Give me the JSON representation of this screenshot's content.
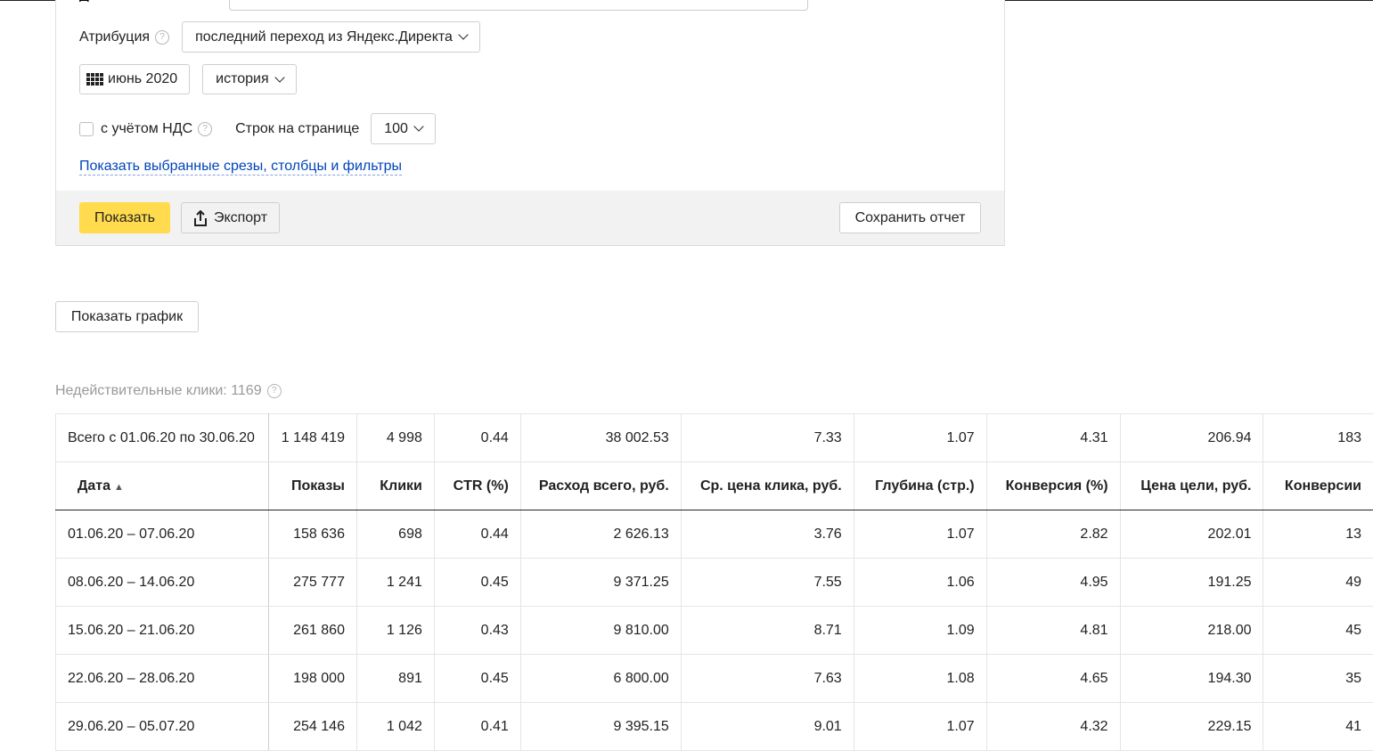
{
  "filters": {
    "attribution_label": "Атрибуция",
    "attribution_value": "последний переход из Яндекс.Директа",
    "period_label": "июнь 2020",
    "history_label": "история",
    "vat_label": "с учётом НДС",
    "rows_per_page_label": "Строк на странице",
    "rows_per_page_value": "100",
    "show_selected_link": "Показать выбранные срезы, столбцы и фильтры",
    "cut_text": "Д"
  },
  "actions": {
    "show_label": "Показать",
    "export_label": "Экспорт",
    "save_report_label": "Сохранить отчет",
    "show_chart_label": "Показать график"
  },
  "invalid_clicks": "Недействительные клики: 1169",
  "table": {
    "total": [
      "Всего с 01.06.20 по 30.06.20",
      "1 148 419",
      "4 998",
      "0.44",
      "38 002.53",
      "7.33",
      "1.07",
      "4.31",
      "206.94",
      "183"
    ],
    "headers": [
      "Дата",
      "Показы",
      "Клики",
      "CTR (%)",
      "Расход всего, руб.",
      "Ср. цена клика, руб.",
      "Глубина (стр.)",
      "Конверсия (%)",
      "Цена цели, руб.",
      "Конверсии"
    ],
    "rows": [
      [
        "01.06.20 – 07.06.20",
        "158 636",
        "698",
        "0.44",
        "2 626.13",
        "3.76",
        "1.07",
        "2.82",
        "202.01",
        "13"
      ],
      [
        "08.06.20 – 14.06.20",
        "275 777",
        "1 241",
        "0.45",
        "9 371.25",
        "7.55",
        "1.06",
        "4.95",
        "191.25",
        "49"
      ],
      [
        "15.06.20 – 21.06.20",
        "261 860",
        "1 126",
        "0.43",
        "9 810.00",
        "8.71",
        "1.09",
        "4.81",
        "218.00",
        "45"
      ],
      [
        "22.06.20 – 28.06.20",
        "198 000",
        "891",
        "0.45",
        "6 800.00",
        "7.63",
        "1.08",
        "4.65",
        "194.30",
        "35"
      ],
      [
        "29.06.20 – 05.07.20",
        "254 146",
        "1 042",
        "0.41",
        "9 395.15",
        "9.01",
        "1.07",
        "4.32",
        "229.15",
        "41"
      ]
    ]
  },
  "colors": {
    "accent": "#ffdb4d",
    "link": "#0044bb"
  }
}
